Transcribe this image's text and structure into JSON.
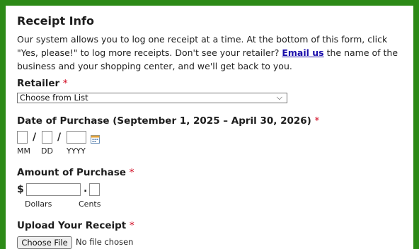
{
  "section": {
    "title": "Receipt Info",
    "intro_before_link": "Our system allows you to log one receipt at a time. At the bottom of this form, click \"Yes, please!\" to log more receipts. Don't see your retailer?",
    "intro_link": "Email us",
    "intro_after_link": "the name of the business and your shopping center, and we'll get back to you."
  },
  "retailer": {
    "label": "Retailer",
    "required_mark": "*",
    "selected": "Choose from List",
    "chevron": "⌵"
  },
  "purchase_date": {
    "label": "Date of Purchase (September 1, 2025 – April 30, 2026)",
    "required_mark": "*",
    "separator": "/",
    "month_hint": "MM",
    "day_hint": "DD",
    "year_hint": "YYYY",
    "calendar_icon": "calendar-icon"
  },
  "amount": {
    "label": "Amount of Purchase",
    "required_mark": "*",
    "currency": "$",
    "decimal": ".",
    "dollars_hint": "Dollars",
    "cents_hint": "Cents"
  },
  "upload": {
    "label": "Upload Your Receipt",
    "required_mark": "*",
    "button_label": "Choose File",
    "status": "No file chosen"
  },
  "colors": {
    "frame_green": "#2c8a17",
    "required_red": "#d0021b",
    "link_blue": "#1a0dab"
  }
}
